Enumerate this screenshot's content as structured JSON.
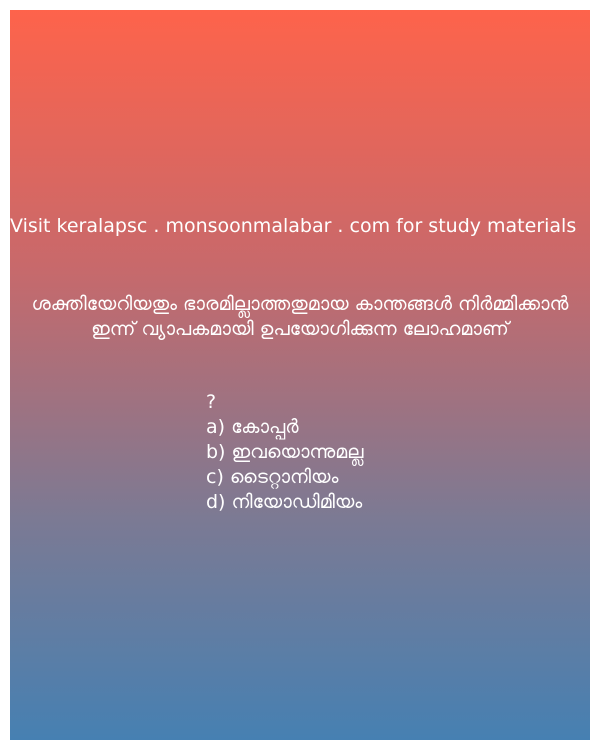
{
  "promo_text": "Visit keralapsc . monsoonmalabar . com for study materials",
  "question": {
    "text": "ശക്തിയേറിയതും ഭാരമില്ലാത്തതുമായ കാന്തങ്ങൾ നിർമ്മിക്കാൻ ഇന്ന് വ്യാപകമായി ഉപയോഗിക്കുന്ന ലോഹമാണ്",
    "mark": "?"
  },
  "options": [
    "a) കോപ്പർ",
    "b) ഇവയൊന്നുമല്ല",
    "c) ടൈറ്റാനിയം",
    "d) നിയോഡിമിയം"
  ],
  "colors": {
    "gradient_top": "#fe634b",
    "gradient_bottom": "#4680b2",
    "text": "#ffffff"
  }
}
